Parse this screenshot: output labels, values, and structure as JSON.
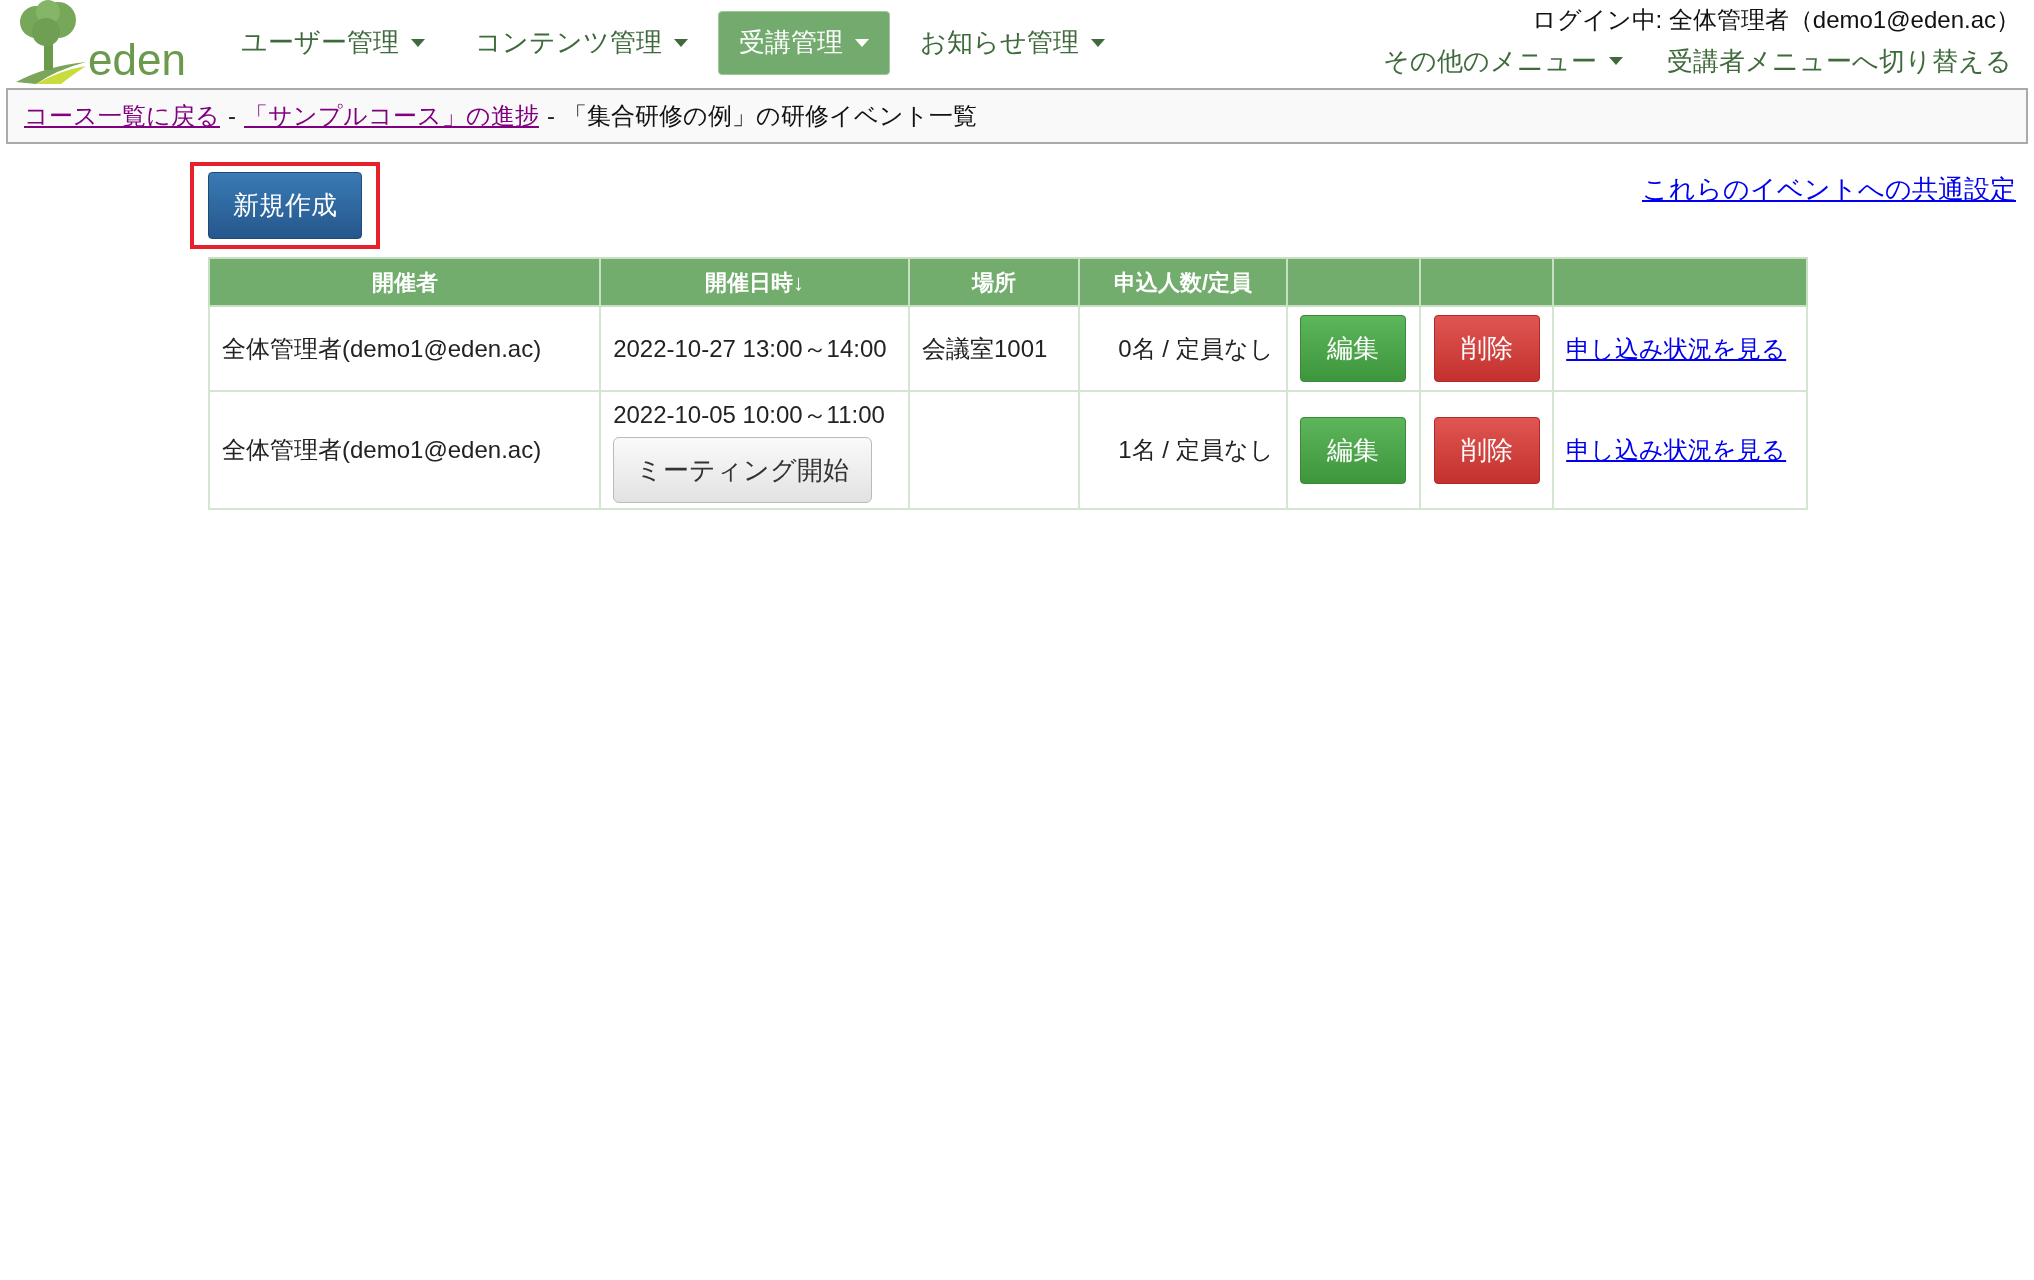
{
  "logo": {
    "text": "eden"
  },
  "nav": [
    {
      "label": "ユーザー管理",
      "selected": false
    },
    {
      "label": "コンテンツ管理",
      "selected": false
    },
    {
      "label": "受講管理",
      "selected": true
    },
    {
      "label": "お知らせ管理",
      "selected": false
    }
  ],
  "login_status": "ログイン中: 全体管理者（demo1@eden.ac）",
  "other_menu": "その他のメニュー",
  "switch_link": "受講者メニューへ切り替える",
  "breadcrumb": [
    {
      "kind": "link",
      "text": "コース一覧に戻る"
    },
    {
      "kind": "separator",
      "text": "-"
    },
    {
      "kind": "link",
      "text": "「サンプルコース」の進捗"
    },
    {
      "kind": "separator",
      "text": "-"
    },
    {
      "kind": "current",
      "text": "「集合研修の例」の研修イベント一覧"
    }
  ],
  "new_button": "新規作成",
  "common_settings_link": "これらのイベントへの共通設定",
  "table": {
    "columns": [
      "開催者",
      "開催日時↓",
      "場所",
      "申込人数/定員",
      "",
      "",
      ""
    ],
    "rows": [
      {
        "organizer": "全体管理者(demo1@eden.ac)",
        "datetime": "2022-10-27 13:00～14:00",
        "place": "会議室1001",
        "applicants": "0名 / 定員なし",
        "edit": "編集",
        "delete": "削除",
        "status_link": "申し込み状況を見る"
      },
      {
        "organizer": "全体管理者(demo1@eden.ac)",
        "datetime": "2022-10-05 10:00～11:00",
        "meeting_button": "ミーティング開始",
        "applicants": "1名 / 定員なし",
        "edit": "編集",
        "delete": "削除",
        "status_link": "申し込み状況を見る"
      }
    ]
  }
}
